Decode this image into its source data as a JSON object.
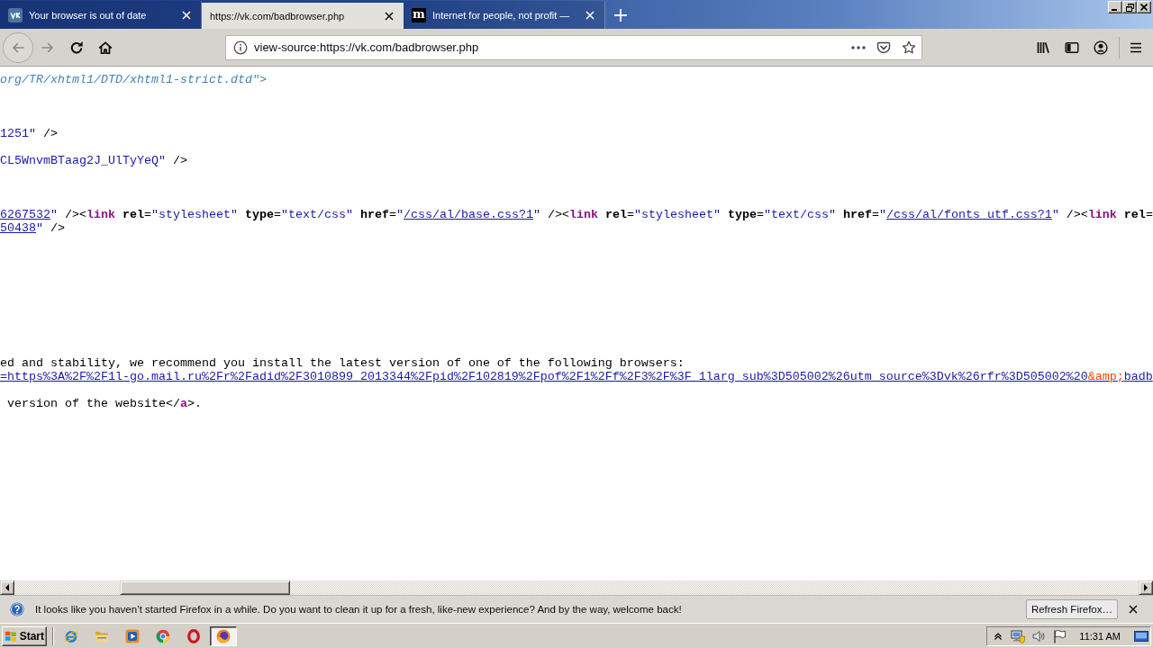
{
  "tabs": [
    {
      "kind": "logo",
      "title": "Your browser is out of date",
      "selected": false
    },
    {
      "kind": "plain",
      "title": "https://vk.com/badbrowser.php",
      "selected": true
    },
    {
      "kind": "letter",
      "logo_text": "m",
      "title": "Internet for people, not profit —",
      "selected": false
    }
  ],
  "toolbar": {
    "nav": [
      {
        "kind": "back",
        "disabled": true
      },
      {
        "kind": "forward",
        "disabled": true
      },
      {
        "kind": "reload",
        "disabled": false
      },
      {
        "kind": "home",
        "disabled": false
      }
    ],
    "address": {
      "value": "view-source:https://vk.com/badbrowser.php"
    }
  },
  "source": {
    "lines": [
      {
        "kind": "code",
        "segments": [
          {
            "kind": "doctype",
            "text": "org/TR/xhtml1/DTD/xhtml1-strict.dtd\">"
          }
        ]
      },
      {
        "kind": "blank"
      },
      {
        "kind": "blank"
      },
      {
        "kind": "blank"
      },
      {
        "kind": "code",
        "segments": [
          {
            "kind": "value",
            "text": "1251\""
          },
          {
            "kind": "text",
            "text": " />"
          }
        ]
      },
      {
        "kind": "blank"
      },
      {
        "kind": "code",
        "segments": [
          {
            "kind": "value",
            "text": "CL5WnvmBTaag2J_UlTyYeQ\""
          },
          {
            "kind": "text",
            "text": " />"
          }
        ]
      },
      {
        "kind": "blank"
      },
      {
        "kind": "blank"
      },
      {
        "kind": "blank"
      },
      {
        "kind": "code",
        "segments": [
          {
            "kind": "link",
            "text": "6267532"
          },
          {
            "kind": "value",
            "text": "\""
          },
          {
            "kind": "text",
            "text": " /><"
          },
          {
            "kind": "tag",
            "text": "link"
          },
          {
            "kind": "attr",
            "text": " rel"
          },
          {
            "kind": "text",
            "text": "="
          },
          {
            "kind": "value",
            "text": "\"stylesheet\""
          },
          {
            "kind": "attr",
            "text": " type"
          },
          {
            "kind": "text",
            "text": "="
          },
          {
            "kind": "value",
            "text": "\"text/css\""
          },
          {
            "kind": "attr",
            "text": " href"
          },
          {
            "kind": "text",
            "text": "="
          },
          {
            "kind": "value",
            "text": "\""
          },
          {
            "kind": "link",
            "text": "/css/al/base.css?1"
          },
          {
            "kind": "value",
            "text": "\""
          },
          {
            "kind": "text",
            "text": " /><"
          },
          {
            "kind": "tag",
            "text": "link"
          },
          {
            "kind": "attr",
            "text": " rel"
          },
          {
            "kind": "text",
            "text": "="
          },
          {
            "kind": "value",
            "text": "\"stylesheet\""
          },
          {
            "kind": "attr",
            "text": " type"
          },
          {
            "kind": "text",
            "text": "="
          },
          {
            "kind": "value",
            "text": "\"text/css\""
          },
          {
            "kind": "attr",
            "text": " href"
          },
          {
            "kind": "text",
            "text": "="
          },
          {
            "kind": "value",
            "text": "\""
          },
          {
            "kind": "link",
            "text": "/css/al/fonts_utf.css?1"
          },
          {
            "kind": "value",
            "text": "\""
          },
          {
            "kind": "text",
            "text": " /><"
          },
          {
            "kind": "tag",
            "text": "link"
          },
          {
            "kind": "attr",
            "text": " rel"
          },
          {
            "kind": "text",
            "text": "="
          }
        ]
      },
      {
        "kind": "code",
        "segments": [
          {
            "kind": "link",
            "text": "50438"
          },
          {
            "kind": "value",
            "text": "\""
          },
          {
            "kind": "text",
            "text": " />"
          }
        ]
      },
      {
        "kind": "blank"
      },
      {
        "kind": "blank"
      },
      {
        "kind": "blank"
      },
      {
        "kind": "blank"
      },
      {
        "kind": "blank"
      },
      {
        "kind": "blank"
      },
      {
        "kind": "blank"
      },
      {
        "kind": "blank"
      },
      {
        "kind": "blank"
      },
      {
        "kind": "code",
        "segments": [
          {
            "kind": "text",
            "text": "ed and stability, we recommend you install the latest version of one of the following browsers:"
          }
        ]
      },
      {
        "kind": "code",
        "segments": [
          {
            "kind": "link",
            "text": "=https%3A%2F%2F1l-go.mail.ru%2Fr%2Fadid%2F3010899_2013344%2Fpid%2F102819%2Fpof%2F1%2Ff%2F3%2F%3F_1larg_sub%3D505002%26utm_source%3Dvk%26rfr%3D505002%20"
          },
          {
            "kind": "entity",
            "text": "&amp;"
          },
          {
            "kind": "link",
            "text": "badb"
          }
        ]
      },
      {
        "kind": "blank"
      },
      {
        "kind": "code",
        "segments": [
          {
            "kind": "text",
            "text": " version of the website</"
          },
          {
            "kind": "tag",
            "text": "a"
          },
          {
            "kind": "text",
            "text": ">."
          }
        ]
      }
    ]
  },
  "notification": {
    "message": "It looks like you haven’t started Firefox in a while. Do you want to clean it up for a fresh, like-new experience? And by the way, welcome back!",
    "button": "Refresh Firefox…"
  },
  "taskbar": {
    "start": "Start",
    "apps": [
      {
        "kind": "ie",
        "active": false
      },
      {
        "kind": "folder",
        "active": false
      },
      {
        "kind": "player",
        "active": false
      },
      {
        "kind": "chrome",
        "active": false
      },
      {
        "kind": "opera",
        "active": false
      },
      {
        "kind": "firefox",
        "active": true
      }
    ],
    "clock": "11:31 AM"
  }
}
